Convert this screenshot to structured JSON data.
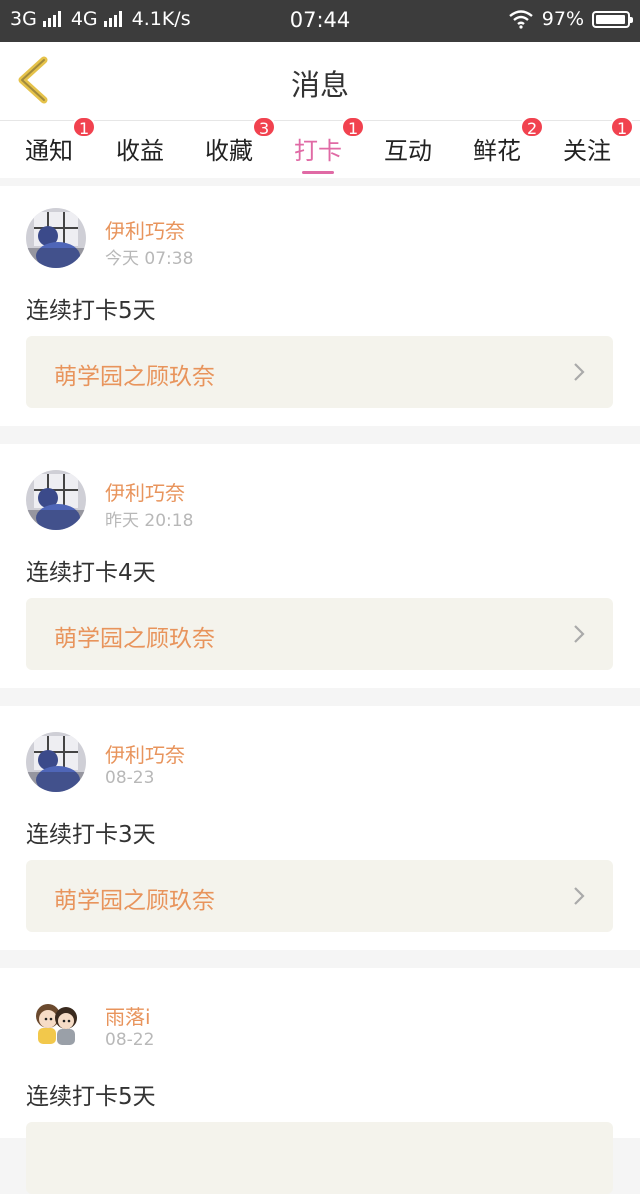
{
  "status_bar": {
    "network": "3G",
    "network2": "4G",
    "speed": "4.1K/s",
    "time": "07:44",
    "battery": "97%",
    "battery_level": 0.97
  },
  "nav": {
    "title": "消息",
    "back_icon": "chevron-left-icon"
  },
  "tabs": [
    {
      "label": "通知",
      "badge": "1"
    },
    {
      "label": "收益",
      "badge": ""
    },
    {
      "label": "收藏",
      "badge": "3"
    },
    {
      "label": "打卡",
      "badge": "1",
      "active": true
    },
    {
      "label": "互动",
      "badge": ""
    },
    {
      "label": "鲜花",
      "badge": "2"
    },
    {
      "label": "关注",
      "badge": "1"
    }
  ],
  "colors": {
    "accent": "#e06aa5",
    "name": "#e8945c",
    "badge": "#f1424f"
  },
  "cards": [
    {
      "user": "伊利巧奈",
      "time": "今天 07:38",
      "content": "连续打卡5天",
      "link": "萌学园之顾玖奈",
      "avatar": "user-photo-avatar"
    },
    {
      "user": "伊利巧奈",
      "time": "昨天 20:18",
      "content": "连续打卡4天",
      "link": "萌学园之顾玖奈",
      "avatar": "user-photo-avatar"
    },
    {
      "user": "伊利巧奈",
      "time": "08-23",
      "content": "连续打卡3天",
      "link": "萌学园之顾玖奈",
      "avatar": "user-photo-avatar"
    },
    {
      "user": "雨落i",
      "time": "08-22",
      "content": "连续打卡5天",
      "link": "",
      "avatar": "cartoon-avatar"
    }
  ]
}
